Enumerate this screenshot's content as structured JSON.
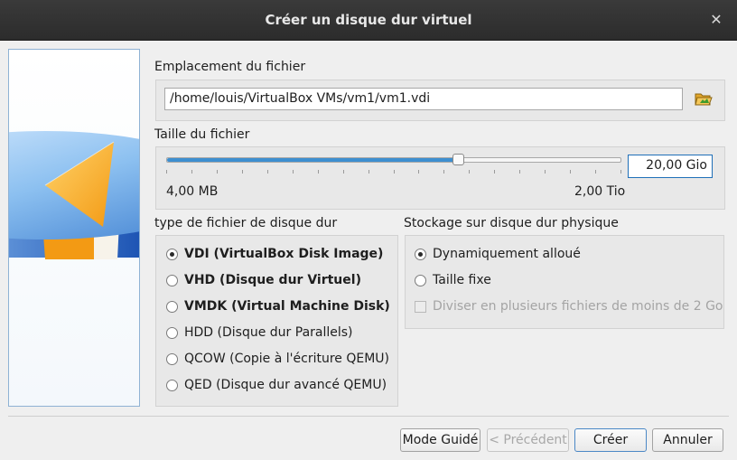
{
  "window": {
    "title": "Créer un disque dur virtuel"
  },
  "location": {
    "label": "Emplacement du fichier",
    "path": "/home/louis/VirtualBox VMs/vm1/vm1.vdi"
  },
  "size": {
    "label": "Taille du fichier",
    "value": "20,00 Gio",
    "min_label": "4,00 MB",
    "max_label": "2,00 Tio",
    "slider_position_fraction": 0.64
  },
  "file_type": {
    "label": "type de fichier de disque dur",
    "options": [
      {
        "label": "VDI (VirtualBox Disk Image)",
        "selected": true
      },
      {
        "label": "VHD (Disque dur Virtuel)",
        "selected": false
      },
      {
        "label": "VMDK (Virtual Machine Disk)",
        "selected": false
      },
      {
        "label": "HDD (Disque dur Parallels)",
        "selected": false
      },
      {
        "label": "QCOW (Copie à l'écriture QEMU)",
        "selected": false
      },
      {
        "label": "QED (Disque dur avancé QEMU)",
        "selected": false
      }
    ]
  },
  "storage": {
    "label": "Stockage sur disque dur physique",
    "options": [
      {
        "label": "Dynamiquement alloué",
        "selected": true
      },
      {
        "label": "Taille fixe",
        "selected": false
      }
    ],
    "split_label": "Diviser en plusieurs fichiers de moins de 2 Go"
  },
  "buttons": {
    "guided": "Mode Guidé",
    "previous": "< Précédent",
    "create": "Créer",
    "cancel": "Annuler"
  },
  "icons": {
    "close": "close-icon",
    "folder": "folder-open-icon",
    "illustration": "hard-disk-illustration"
  }
}
